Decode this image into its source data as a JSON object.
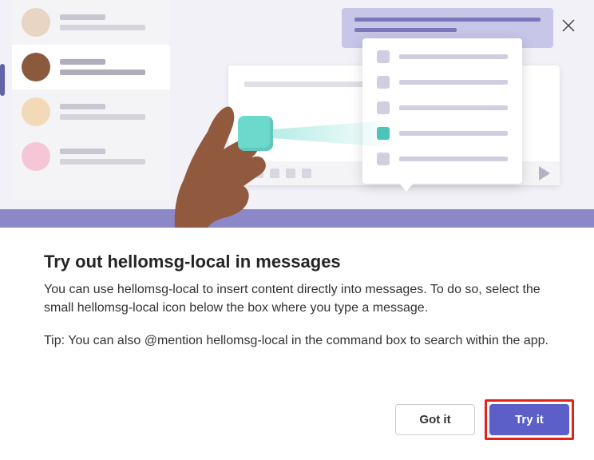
{
  "dialog": {
    "title": "Try out hellomsg-local in messages",
    "body_1": "You can use hellomsg-local to insert content directly into messages. To do so, select the small hellomsg-local icon below the box where you type a message.",
    "body_2": "Tip: You can also @mention hellomsg-local in the command box to search within the app.",
    "buttons": {
      "secondary": "Got it",
      "primary": "Try it"
    }
  },
  "colors": {
    "accent": "#5b5fc7",
    "highlight": "#e2231a",
    "teal": "#6cd9cc"
  }
}
